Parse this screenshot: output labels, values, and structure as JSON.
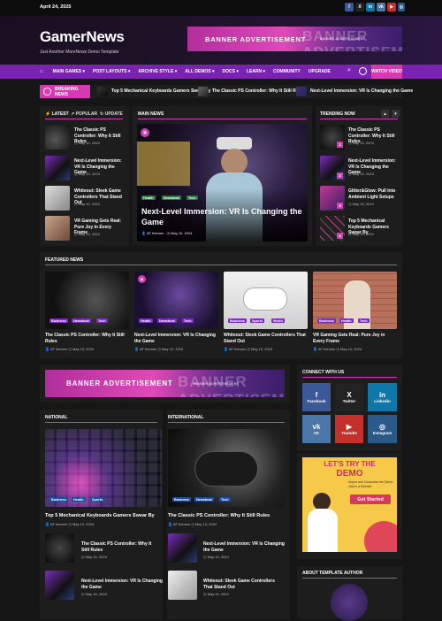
{
  "topbar": {
    "date": "April 24, 2025"
  },
  "header": {
    "logo": "GamerNews",
    "tagline": "Just Another MoreNews Demo Template"
  },
  "banner": {
    "title": "BANNER ADVERTISEMENT",
    "subtitle": "BANNER ADVERTISEMENT",
    "ghost": "BANNER ADVERTISEMENT"
  },
  "nav": {
    "items": [
      "MAIN GAMES ▾",
      "POST LAYOUTS ▾",
      "ARCHIVE STYLE ▾",
      "ALL DEMOS ▾",
      "DOCS ▾",
      "LEARN ▾",
      "COMMUNITY",
      "UPGRADE"
    ],
    "watch": "WATCH VIDEO"
  },
  "breaking": {
    "label": "BREAKING NEWS",
    "items": [
      "Top 5 Mechanical Keyboards Gamers Swear By",
      "The Classic PS Controller: Why It Still Rules",
      "Next-Level Immersion: VR Is Changing the Game"
    ]
  },
  "tabs": {
    "latest": "LATEST",
    "popular": "POPULAR",
    "update": "UPDATE"
  },
  "latest": [
    {
      "title": "The Classic PS Controller: Why It Still Rules",
      "date": "May 10, 2024"
    },
    {
      "title": "Next-Level Immersion: VR Is Changing the Game",
      "date": "May 10, 2024"
    },
    {
      "title": "Whiteout: Sleek Game Controllers That Stand Out",
      "date": "May 10, 2024"
    },
    {
      "title": "VR Gaming Gets Real: Pure Joy in Every Frame",
      "date": "May 10, 2024"
    }
  ],
  "main_news": {
    "header": "MAIN NEWS",
    "tags": [
      "Health",
      "Newsbeat",
      "Tech"
    ],
    "title": "Next-Level Immersion: VR Is Changing the Game",
    "author": "AF themes",
    "date": "May 10, 2024"
  },
  "trending": {
    "header": "TRENDING NOW",
    "items": [
      {
        "num": "1",
        "title": "The Classic PS Controller: Why It Still Rules",
        "date": "May 10, 2024"
      },
      {
        "num": "2",
        "title": "Next-Level Immersion: VR Is Changing the Game",
        "date": "May 10, 2024"
      },
      {
        "num": "3",
        "title": "Glitter&Glow: Pull Into Ambient Light Setups",
        "date": "May 10, 2024"
      },
      {
        "num": "4",
        "title": "Top 5 Mechanical Keyboards Gamers Swear By",
        "date": "May 10, 2024"
      }
    ]
  },
  "featured": {
    "header": "FEATURED NEWS",
    "items": [
      {
        "title": "The Classic PS Controller: Why It Still Rules",
        "tags": [
          "Business",
          "Newsbeat",
          "Tech"
        ],
        "author": "AF themes",
        "date": "May 10, 2024"
      },
      {
        "title": "Next-Level Immersion: VR Is Changing the Game",
        "tags": [
          "Health",
          "Newsbeat",
          "Tech"
        ],
        "author": "AF themes",
        "date": "May 10, 2024"
      },
      {
        "title": "Whiteout: Sleek Game Controllers That Stand Out",
        "tags": [
          "Business",
          "Sports",
          "World"
        ],
        "author": "AF themes",
        "date": "May 10, 2024"
      },
      {
        "title": "VR Gaming Gets Real: Pure Joy in Every Frame",
        "tags": [
          "Business",
          "Health",
          "Tech"
        ],
        "author": "AF themes",
        "date": "May 10, 2024"
      }
    ]
  },
  "national": {
    "header": "NATIONAL",
    "tags": [
      "Business",
      "Health",
      "Sports"
    ],
    "title": "Top 5 Mechanical Keyboards Gamers Swear By",
    "author": "AF themes",
    "date": "May 10, 2024",
    "list": [
      {
        "title": "The Classic PS Controller: Why It Still Rules",
        "date": "May 10, 2024"
      },
      {
        "title": "Next-Level Immersion: VR Is Changing the Game",
        "date": "May 10, 2024"
      }
    ]
  },
  "international": {
    "header": "INTERNATIONAL",
    "tags": [
      "Business",
      "Newsbeat",
      "Tech"
    ],
    "title": "The Classic PS Controller: Why It Still Rules",
    "author": "AF themes",
    "date": "May 10, 2024",
    "list": [
      {
        "title": "Next-Level Immersion: VR Is Changing the Game",
        "date": "May 10, 2024"
      },
      {
        "title": "Whiteout: Sleek Game Controllers That Stand Out",
        "date": "May 10, 2024"
      }
    ]
  },
  "connect": {
    "header": "CONNECT WITH US",
    "tiles": [
      {
        "name": "Facebook",
        "glyph": "f",
        "color": "#3b5998"
      },
      {
        "name": "Twitter",
        "glyph": "X",
        "color": "#222222"
      },
      {
        "name": "Linkedin",
        "glyph": "in",
        "color": "#0e76a8"
      },
      {
        "name": "VK",
        "glyph": "vk",
        "color": "#4a76a8"
      },
      {
        "name": "Youtube",
        "glyph": "▶",
        "color": "#c4302b"
      },
      {
        "name": "Instagram",
        "glyph": "◎",
        "color": "#2a5a8a"
      }
    ]
  },
  "demo_ad": {
    "title1": "LET'S TRY THE",
    "title2": "DEMO",
    "body": "Import and Customize the Demo. Just in a Minutes",
    "button": "Get Started"
  },
  "author": {
    "header": "ABOUT TEMPLATE AUTHOR"
  },
  "colors": {
    "accent": "#d63ab3",
    "nav": "#7a23b0",
    "bg": "#161616",
    "panel": "#1d1d1d"
  }
}
